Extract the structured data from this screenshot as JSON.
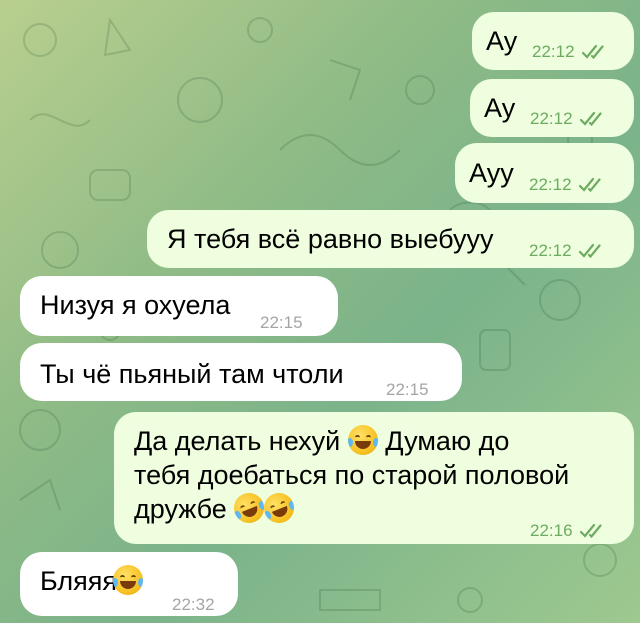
{
  "colors": {
    "outgoing_bubble": "#eefedf",
    "incoming_bubble": "#ffffff",
    "outgoing_time": "#6dab60",
    "incoming_time": "#a5a5a5"
  },
  "messages": [
    {
      "text": "Ау",
      "time": "22:12",
      "direction": "outgoing",
      "status_icon": "double-check-icon"
    },
    {
      "text": "Ау",
      "time": "22:12",
      "direction": "outgoing",
      "status_icon": "double-check-icon"
    },
    {
      "text": "Ауу",
      "time": "22:12",
      "direction": "outgoing",
      "status_icon": "double-check-icon"
    },
    {
      "text": "Я тебя всё равно выебууу",
      "time": "22:12",
      "direction": "outgoing",
      "status_icon": "double-check-icon"
    },
    {
      "text": "Низуя я охуела",
      "time": "22:15",
      "direction": "incoming"
    },
    {
      "text": "Ты чё пьяный там чтоли",
      "time": "22:15",
      "direction": "incoming"
    },
    {
      "lines": [
        "Да делать нехуй",
        "Думаю до",
        "тебя доебаться по старой половой",
        "дружбе"
      ],
      "emoji": [
        "face-with-tears-of-joy-icon",
        "rolling-on-floor-laughing-icon",
        "rolling-on-floor-laughing-icon"
      ],
      "time": "22:16",
      "direction": "outgoing",
      "status_icon": "double-check-icon"
    },
    {
      "text": "Бляяя",
      "emoji": [
        "face-with-tears-of-joy-icon"
      ],
      "time": "22:32",
      "direction": "incoming"
    }
  ]
}
